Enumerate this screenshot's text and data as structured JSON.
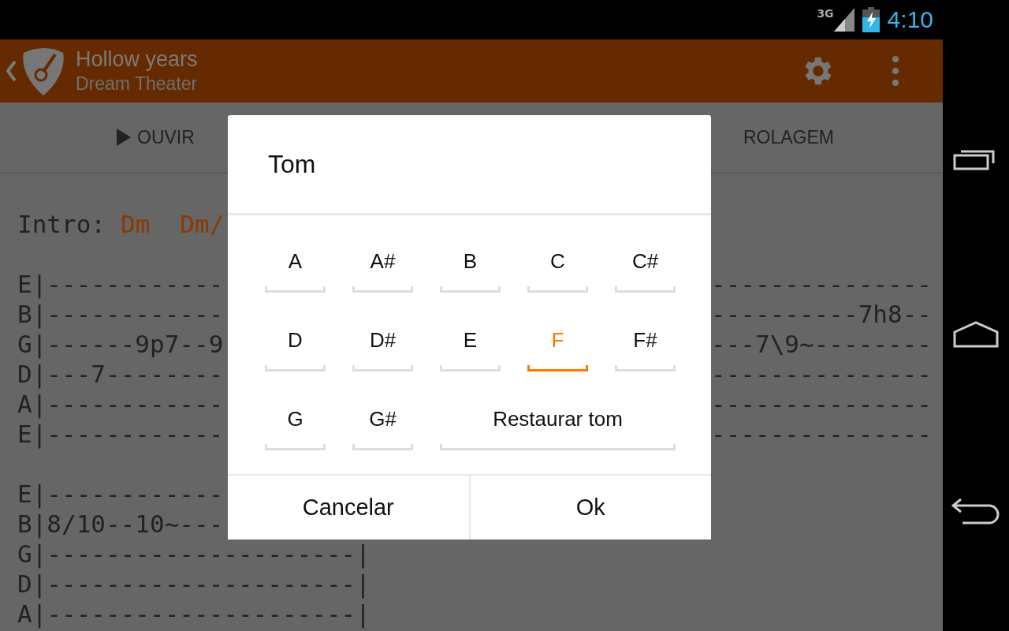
{
  "status_bar": {
    "network": "3G",
    "time": "4:10"
  },
  "app_bar": {
    "title": "Hollow years",
    "subtitle": "Dream Theater"
  },
  "toolbar": {
    "listen": "OUVIR",
    "scroll": "ROLAGEM"
  },
  "tab": {
    "intro_label": "Intro:",
    "chords": [
      "Dm",
      "Dm/"
    ],
    "staves": [
      [
        {
          "left": "E|------------",
          "right": "---------------"
        },
        {
          "left": "B|------------",
          "right": "----------7h8--"
        },
        {
          "left": "G|------9p7--9",
          "right": "---7\\9~--------"
        },
        {
          "left": "D|---7--------",
          "right": "---------------"
        },
        {
          "left": "A|------------",
          "right": "---------------"
        },
        {
          "left": "E|------------",
          "right": "---------------"
        }
      ],
      [
        {
          "left": "E|------------"
        },
        {
          "left": "B|8/10--10~---"
        },
        {
          "left": "G|---------------------|"
        },
        {
          "left": "D|---------------------|"
        },
        {
          "left": "A|---------------------|"
        }
      ]
    ]
  },
  "dialog": {
    "title": "Tom",
    "keys": [
      {
        "label": "A",
        "kind": "key",
        "selected": false
      },
      {
        "label": "A#",
        "kind": "key",
        "selected": false
      },
      {
        "label": "B",
        "kind": "key",
        "selected": false
      },
      {
        "label": "C",
        "kind": "key",
        "selected": false
      },
      {
        "label": "C#",
        "kind": "key",
        "selected": false
      },
      {
        "label": "D",
        "kind": "key",
        "selected": false
      },
      {
        "label": "D#",
        "kind": "key",
        "selected": false
      },
      {
        "label": "E",
        "kind": "key",
        "selected": false
      },
      {
        "label": "F",
        "kind": "key",
        "selected": true
      },
      {
        "label": "F#",
        "kind": "key",
        "selected": false
      },
      {
        "label": "G",
        "kind": "key",
        "selected": false
      },
      {
        "label": "G#",
        "kind": "key",
        "selected": false
      },
      {
        "label": "Restaurar tom",
        "kind": "reset",
        "selected": false
      }
    ],
    "buttons": [
      "Cancelar",
      "Ok"
    ]
  }
}
